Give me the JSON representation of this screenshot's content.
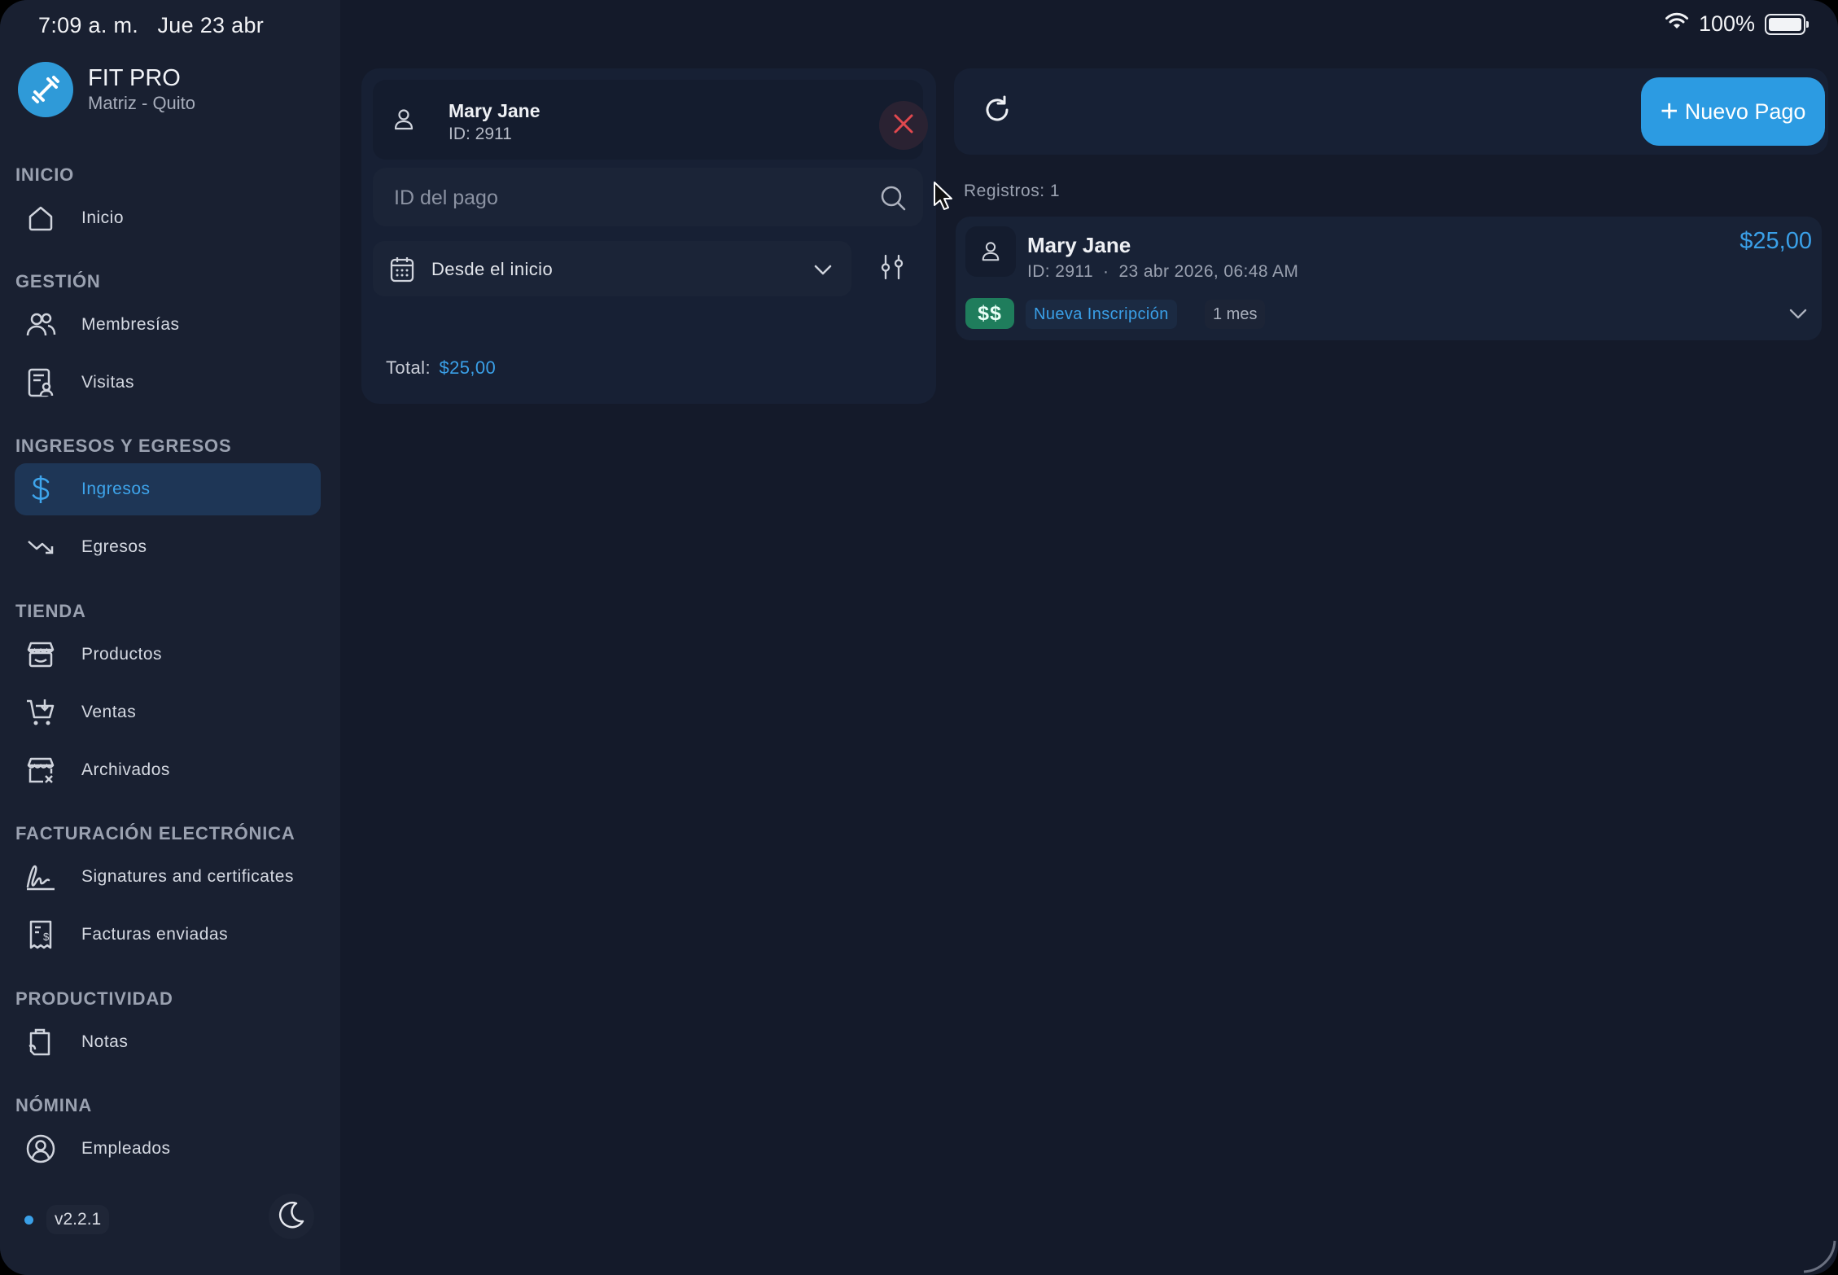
{
  "status_bar": {
    "time": "7:09 a. m.",
    "date": "Jue 23 abr",
    "battery": "100%"
  },
  "brand": {
    "title": "FIT PRO",
    "subtitle": "Matriz - Quito"
  },
  "sidebar": {
    "sections": [
      {
        "title": "INICIO",
        "items": [
          {
            "label": "Inicio",
            "icon": "home-icon"
          }
        ]
      },
      {
        "title": "GESTIÓN",
        "items": [
          {
            "label": "Membresías",
            "icon": "users-icon"
          },
          {
            "label": "Visitas",
            "icon": "visits-icon"
          }
        ]
      },
      {
        "title": "INGRESOS Y EGRESOS",
        "items": [
          {
            "label": "Ingresos",
            "icon": "dollar-icon",
            "active": true
          },
          {
            "label": "Egresos",
            "icon": "trend-down-icon"
          }
        ]
      },
      {
        "title": "TIENDA",
        "items": [
          {
            "label": "Productos",
            "icon": "store-icon"
          },
          {
            "label": "Ventas",
            "icon": "cart-icon"
          },
          {
            "label": "Archivados",
            "icon": "archived-store-icon"
          }
        ]
      },
      {
        "title": "FACTURACIÓN ELECTRÓNICA",
        "items": [
          {
            "label": "Signatures and certificates",
            "icon": "signature-icon"
          },
          {
            "label": "Facturas enviadas",
            "icon": "invoice-icon"
          }
        ]
      },
      {
        "title": "PRODUCTIVIDAD",
        "items": [
          {
            "label": "Notas",
            "icon": "notes-icon"
          }
        ]
      },
      {
        "title": "NÓMINA",
        "items": [
          {
            "label": "Empleados",
            "icon": "employee-icon"
          }
        ]
      }
    ],
    "version": "v2.2.1"
  },
  "filters": {
    "client": {
      "name": "Mary Jane",
      "id": "ID: 2911"
    },
    "search_placeholder": "ID del pago",
    "date_range": "Desde el inicio",
    "total_label": "Total:",
    "total_amount": "$25,00"
  },
  "toolbar": {
    "new_payment": "Nuevo Pago"
  },
  "records": {
    "count_label": "Registros: 1",
    "items": [
      {
        "name": "Mary Jane",
        "id": "ID: 2911",
        "datetime": "23 abr 2026, 06:48 AM",
        "amount": "$25,00",
        "badge": "$$",
        "type": "Nueva Inscripción",
        "period": "1 mes"
      }
    ]
  },
  "colors": {
    "accent": "#2c9be2",
    "background": "#141a2a",
    "sidebar": "#192031",
    "money_badge": "#1f7d5c",
    "close": "#e0484e"
  }
}
